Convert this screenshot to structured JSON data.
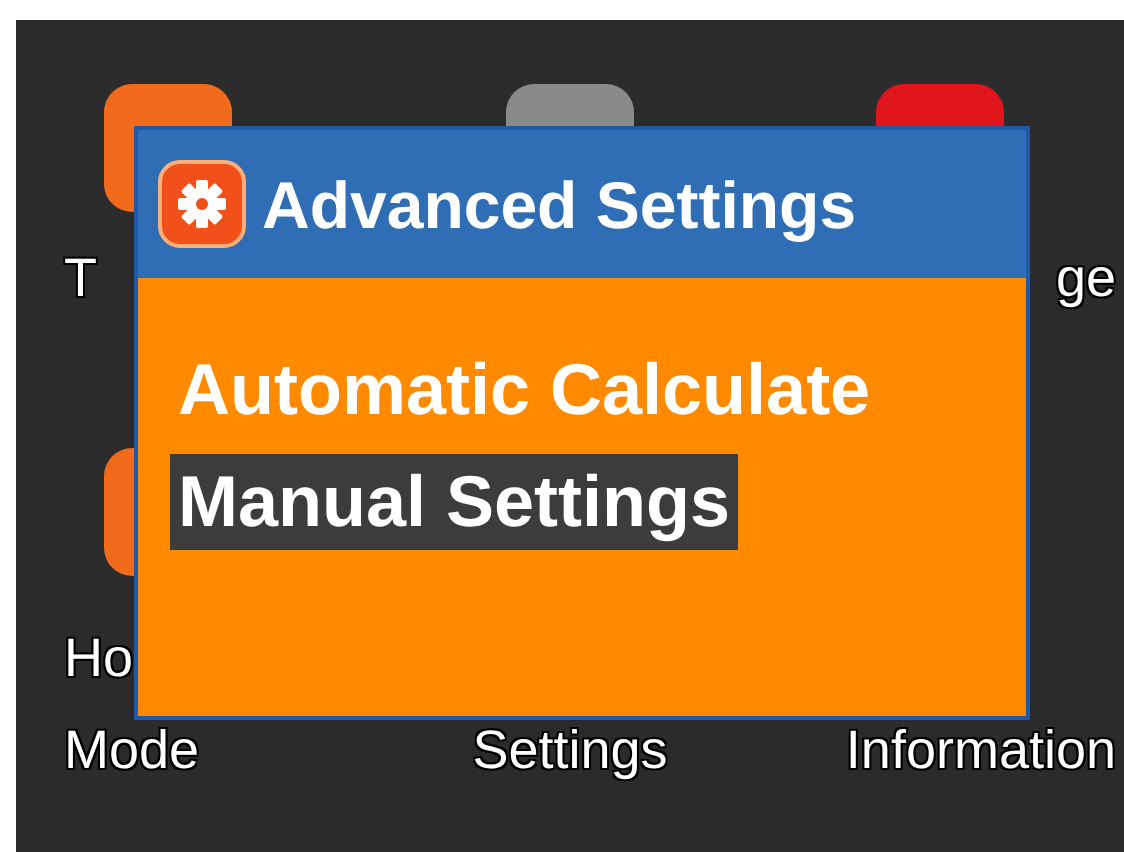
{
  "grid": [
    {
      "color": "#f26a1b",
      "label_lines": [
        "T"
      ]
    },
    {
      "color": "#8a8a8a"
    },
    {
      "color": "#e0141b",
      "label_lines": [
        "ge"
      ]
    },
    {
      "color": "#f26a1b",
      "label_lines": [
        "Ho",
        "Mode"
      ]
    },
    {
      "label_lines": [
        "Settings"
      ]
    },
    {
      "label_lines": [
        "Information"
      ]
    }
  ],
  "dialog": {
    "title": "Advanced Settings",
    "items": [
      {
        "label": "Automatic Calculate",
        "selected": false
      },
      {
        "label": "Manual Settings",
        "selected": true
      }
    ]
  }
}
